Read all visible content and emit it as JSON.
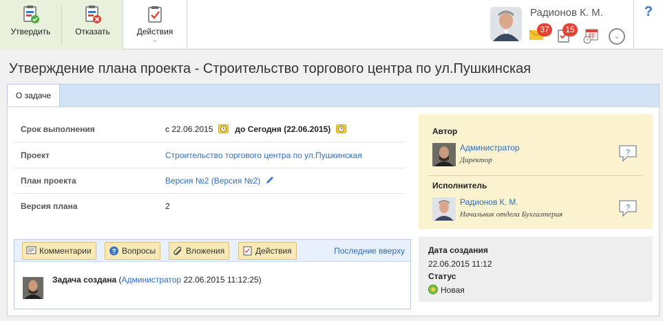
{
  "toolbar": {
    "approve_label": "Утвердить",
    "reject_label": "Отказать",
    "actions_label": "Действия"
  },
  "user": {
    "name": "Радионов К. М.",
    "mail_count": "37",
    "task_count": "15"
  },
  "help_label": "?",
  "page": {
    "title": "Утверждение плана проекта - Строительство торгового центра по ул.Пушкинская"
  },
  "tabs": [
    {
      "label": "О задаче",
      "active": true
    }
  ],
  "fields": {
    "deadline": {
      "label": "Срок выполнения",
      "from": "с 22.06.2015",
      "to": "до Сегодня (22.06.2015)"
    },
    "project": {
      "label": "Проект",
      "value": "Строительство торгового центра по ул.Пушкинская"
    },
    "plan": {
      "label": "План проекта",
      "value": "Версия №2 (Версия №2)"
    },
    "version": {
      "label": "Версия плана",
      "value": "2"
    }
  },
  "people": {
    "author_heading": "Автор",
    "author_name": "Администратор",
    "author_role": "Директор",
    "executor_heading": "Исполнитель",
    "executor_name": "Радионов К. М.",
    "executor_role": "Начальник отдела Бухгалтерия"
  },
  "info": {
    "created_heading": "Дата создания",
    "created_value": "22.06.2015 11:12",
    "status_heading": "Статус",
    "status_value": "Новая"
  },
  "comments": {
    "buttons": {
      "comments": "Комментарии",
      "questions": "Вопросы",
      "attachments": "Вложения",
      "actions": "Действия"
    },
    "sort_label": "Последние вверху",
    "entry": {
      "action": "Задача создана",
      "open_paren": "(",
      "author": "Администратор",
      "timestamp": "22.06.2015 11:12:25)"
    }
  },
  "colors": {
    "accent": "#2f6dbd",
    "approve_bg": "#e8f1dc",
    "badge": "#e34334",
    "people_panel": "#fbf2cf",
    "tab_bar": "#d3e3f6"
  }
}
